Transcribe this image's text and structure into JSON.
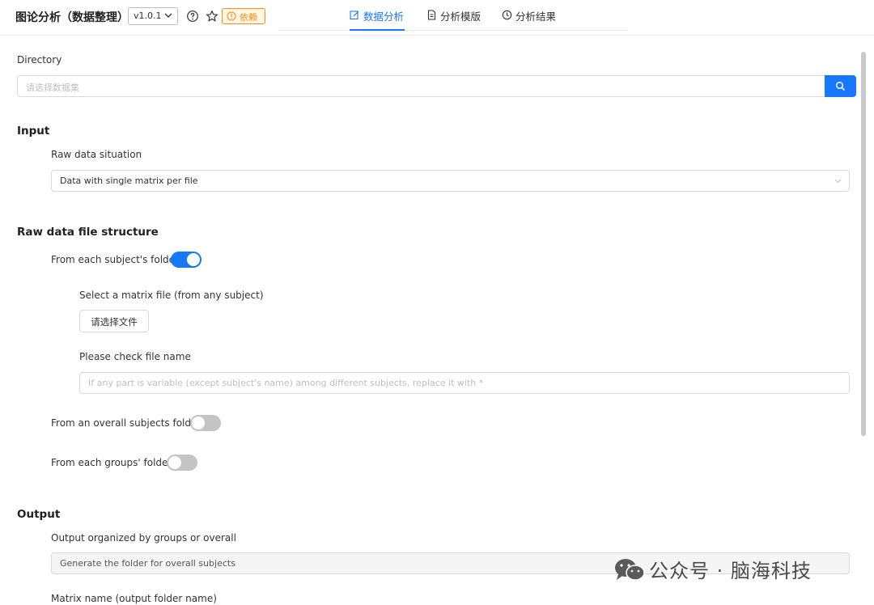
{
  "header": {
    "title": "图论分析（数据整理）",
    "version": "v1.0.1",
    "dependency_label": "依赖",
    "tabs": [
      {
        "label": "数据分析",
        "active": true,
        "icon": "edit-icon"
      },
      {
        "label": "分析模版",
        "active": false,
        "icon": "file-icon"
      },
      {
        "label": "分析结果",
        "active": false,
        "icon": "clock-icon"
      }
    ]
  },
  "directory": {
    "label": "Directory",
    "placeholder": "请选择数据集"
  },
  "input": {
    "title": "Input",
    "raw_label": "Raw data situation",
    "raw_value": "Data with single matrix per file"
  },
  "structure": {
    "title": "Raw data file structure",
    "subject_folder": {
      "label": "From each subject's folder",
      "on": true
    },
    "select_matrix_label": "Select a matrix file (from any subject)",
    "choose_file_button": "请选择文件",
    "check_name_label": "Please check file name",
    "file_name_placeholder": "If any part is variable (except subject's name) among different subjects, replace it with *",
    "overall_folder": {
      "label": "From an overall subjects folder",
      "on": false
    },
    "groups_folder": {
      "label": "From each groups' folder",
      "on": false
    }
  },
  "output": {
    "title": "Output",
    "organized_label": "Output organized by groups or overall",
    "organized_value": "Generate the folder for overall subjects",
    "matrix_name_label": "Matrix name (output folder name)"
  },
  "watermark": "公众号 · 脑海科技",
  "colors": {
    "accent": "#1677ff",
    "warning": "#fa8c16",
    "toggle_off": "#c4c4c4"
  }
}
